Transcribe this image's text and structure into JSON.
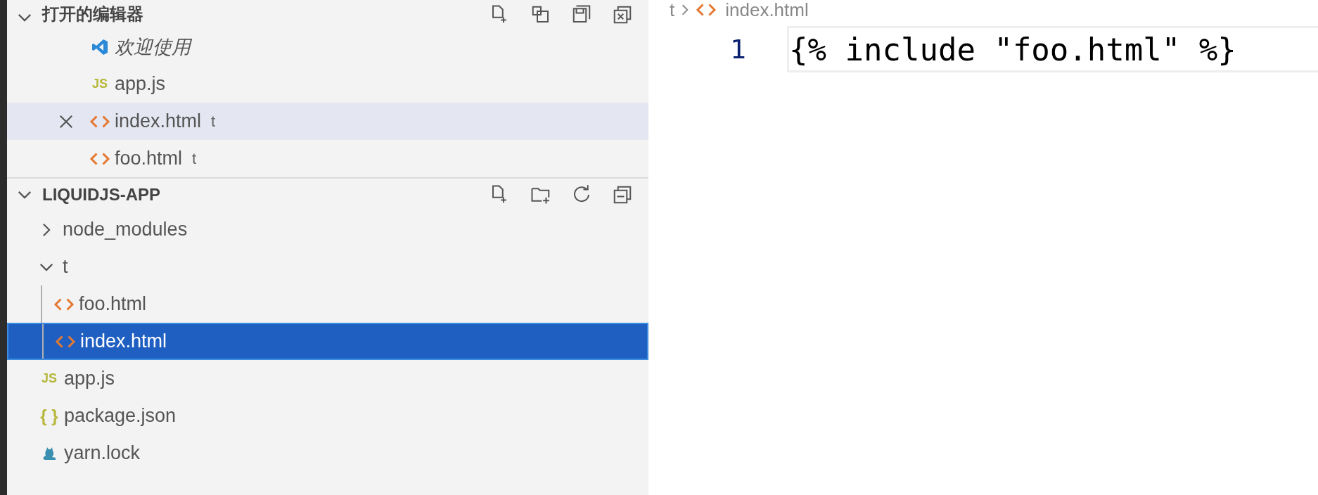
{
  "open_editors": {
    "title": "打开的编辑器",
    "expanded": true,
    "items": [
      {
        "kind": "welcome",
        "name": "欢迎使用",
        "preview": true,
        "hovered": false
      },
      {
        "kind": "js",
        "icon_text": "JS",
        "name": "app.js",
        "preview": false,
        "hovered": false
      },
      {
        "kind": "html",
        "name": "index.html",
        "description": "t",
        "preview": false,
        "hovered": true
      },
      {
        "kind": "html",
        "name": "foo.html",
        "description": "t",
        "preview": false,
        "hovered": false
      }
    ]
  },
  "folder": {
    "title": "LIQUIDJS-APP",
    "expanded": true,
    "items": [
      {
        "kind": "folder",
        "name": "node_modules",
        "expanded": false,
        "selected": false
      },
      {
        "kind": "folder",
        "name": "t",
        "expanded": true,
        "selected": false,
        "children": [
          {
            "kind": "html",
            "name": "foo.html",
            "selected": false
          },
          {
            "kind": "html",
            "name": "index.html",
            "selected": true
          }
        ]
      },
      {
        "kind": "js",
        "icon_text": "JS",
        "name": "app.js",
        "selected": false
      },
      {
        "kind": "json",
        "icon_text": "{ }",
        "name": "package.json",
        "selected": false
      },
      {
        "kind": "yarn",
        "name": "yarn.lock",
        "selected": false
      }
    ]
  },
  "editor": {
    "breadcrumb": [
      {
        "kind": "folder",
        "label": "t"
      },
      {
        "kind": "html",
        "label": "index.html"
      }
    ],
    "lines": [
      {
        "number": "1",
        "text": "{% include \"foo.html\" %}",
        "current": true
      }
    ]
  }
}
